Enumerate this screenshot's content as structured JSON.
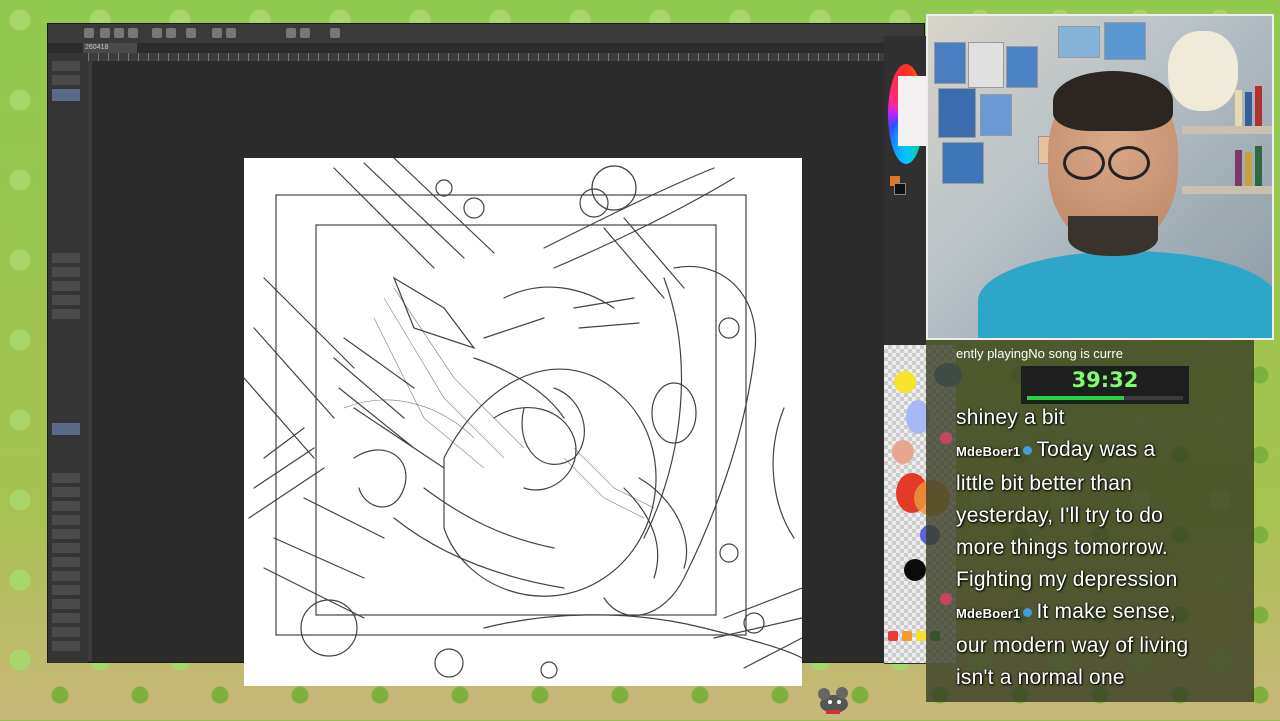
{
  "app": {
    "document_tab": "260418",
    "accent_color": "#5a6a86",
    "colors": {
      "foreground": "#e0782a",
      "background": "#111111"
    }
  },
  "stream": {
    "now_playing_ticker": "ently playingNo song is curre",
    "timer": "39:32",
    "timer_progress_fraction": 0.62,
    "chat": [
      {
        "user": "",
        "text": "shiney a bit"
      },
      {
        "user": "MdeBoer1",
        "text": "Today was a"
      },
      {
        "user": "",
        "text": "little bit better than"
      },
      {
        "user": "",
        "text": "yesterday, I'll try to do"
      },
      {
        "user": "",
        "text": "more things tomorrow."
      },
      {
        "user": "",
        "text": "Fighting my depression"
      },
      {
        "user": "MdeBoer1",
        "text": "It make sense,"
      },
      {
        "user": "",
        "text": "our modern way of living"
      },
      {
        "user": "",
        "text": "isn't a normal one"
      }
    ]
  }
}
